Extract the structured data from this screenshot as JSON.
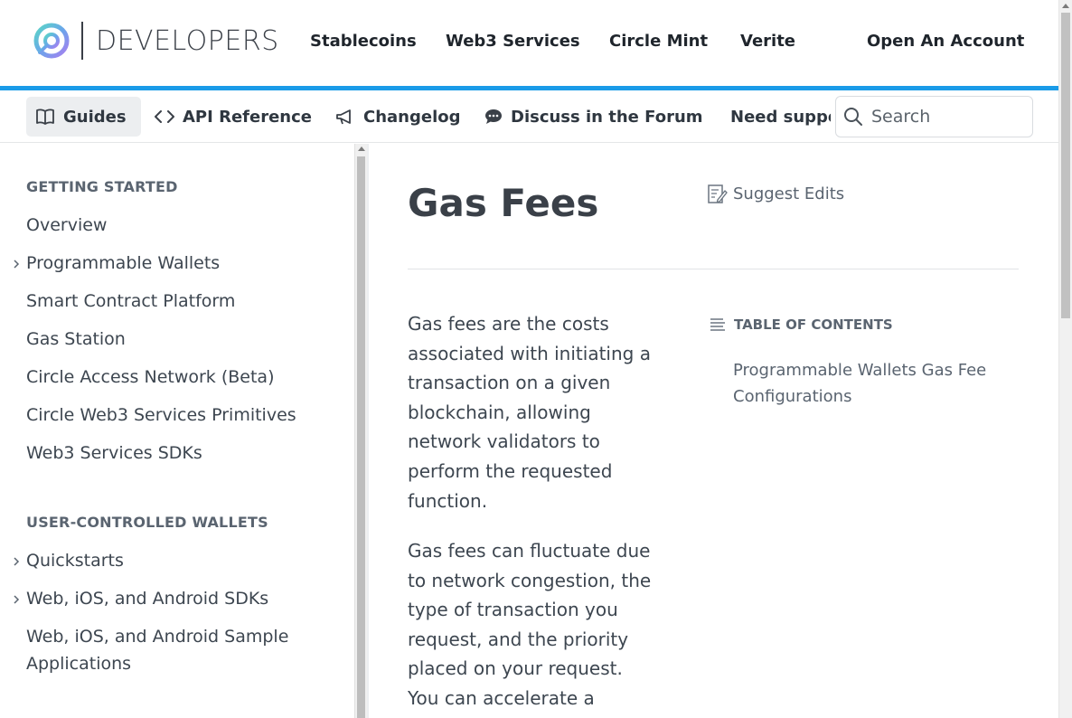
{
  "header": {
    "logo_text": "DEVELOPERS",
    "nav": [
      "Stablecoins",
      "Web3 Services",
      "Circle Mint",
      "Verite"
    ],
    "cta": "Open An Account",
    "accent_color": "#1a9be8"
  },
  "subnav": {
    "items": [
      {
        "label": "Guides",
        "icon": "book-icon",
        "active": true
      },
      {
        "label": "API Reference",
        "icon": "code-icon"
      },
      {
        "label": "Changelog",
        "icon": "megaphone-icon"
      },
      {
        "label": "Discuss in the Forum",
        "icon": "chat-bubble-icon"
      },
      {
        "label": "Need support?",
        "icon": "comments-icon"
      }
    ],
    "search_placeholder": "Search"
  },
  "sidebar": {
    "sections": [
      {
        "title": "GETTING STARTED"
      },
      {
        "title": "USER-CONTROLLED WALLETS"
      }
    ],
    "items": [
      {
        "label": "Overview"
      },
      {
        "label": "Programmable Wallets",
        "expandable": true
      },
      {
        "label": "Smart Contract Platform"
      },
      {
        "label": "Gas Station"
      },
      {
        "label": "Circle Access Network (Beta)"
      },
      {
        "label": "Circle Web3 Services Primitives"
      },
      {
        "label": "Web3 Services SDKs"
      },
      {
        "label": "Quickstarts",
        "expandable": true
      },
      {
        "label": "Web, iOS, and Android SDKs",
        "expandable": true
      },
      {
        "label": "Web, iOS, and Android Sample Applications"
      }
    ]
  },
  "main": {
    "title": "Gas Fees",
    "suggest_edits": "Suggest Edits",
    "paragraphs": [
      "Gas fees are the costs associated with initiating a transaction on a given blockchain, allowing network validators to perform the requested function.",
      "Gas fees can fluctuate due to network congestion, the type of transaction you request, and the priority placed on your request. You can accelerate a"
    ],
    "toc": {
      "title": "TABLE OF CONTENTS",
      "links": [
        "Programmable Wallets Gas Fee Configurations"
      ]
    }
  }
}
